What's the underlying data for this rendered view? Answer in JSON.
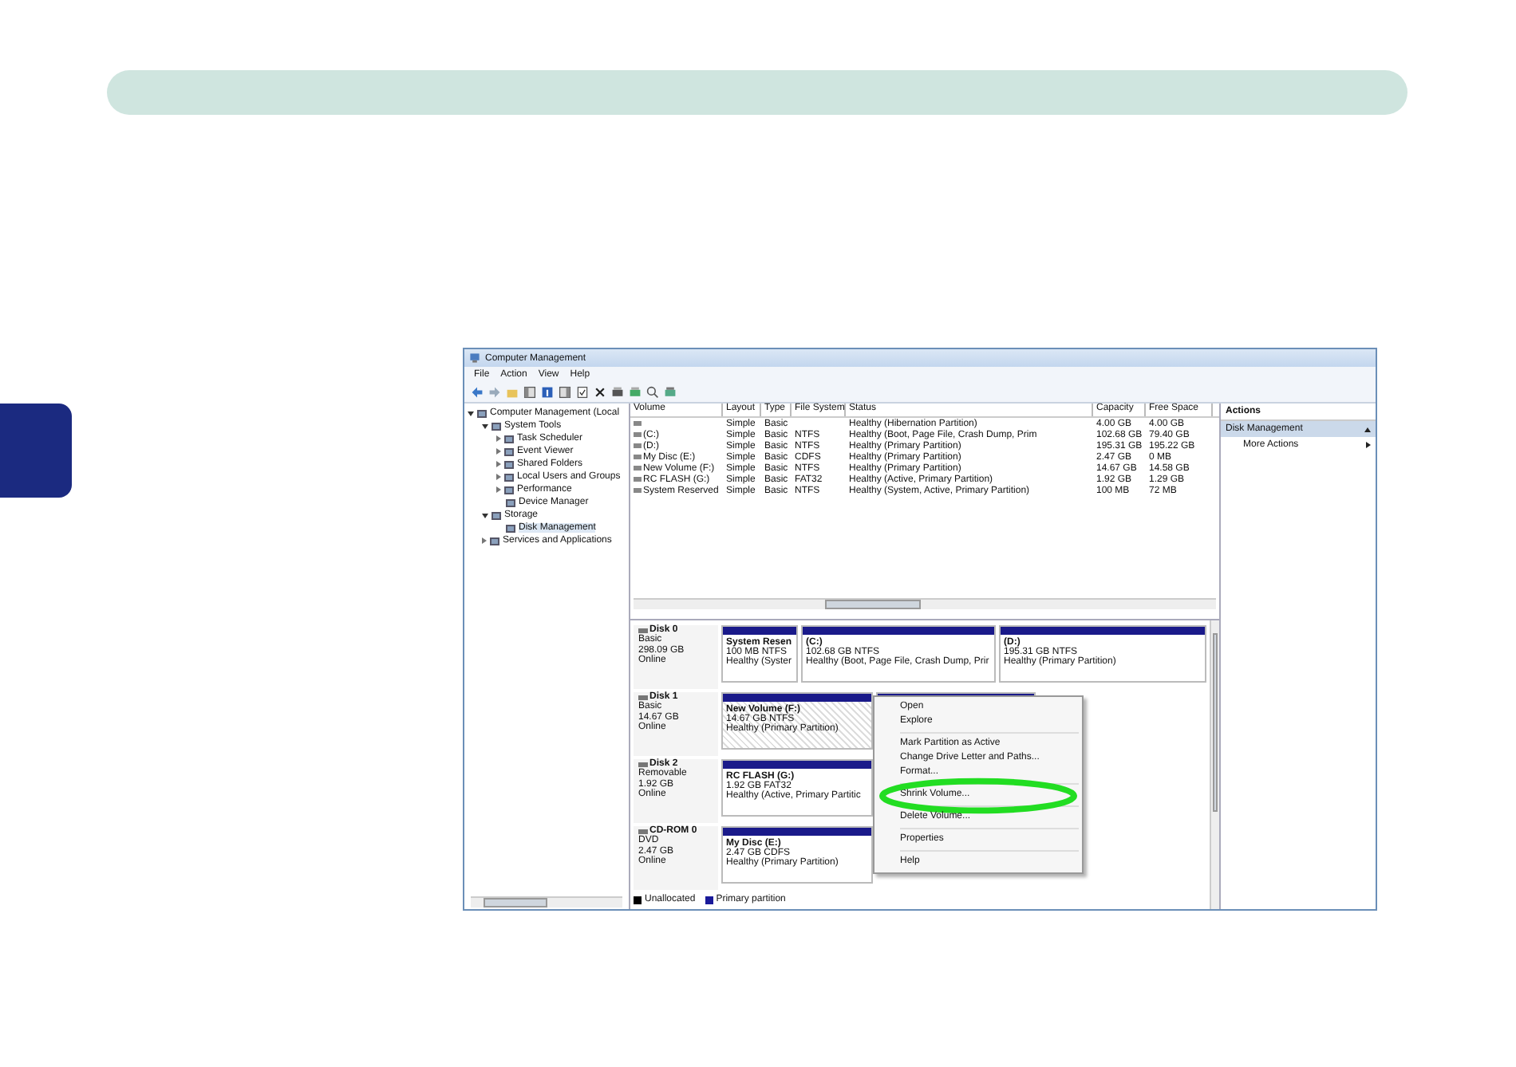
{
  "window": {
    "title": "Computer Management"
  },
  "menu": [
    "File",
    "Action",
    "View",
    "Help"
  ],
  "tree": [
    {
      "label": "Computer Management (Local",
      "expanded": true,
      "children": [
        {
          "label": "System Tools",
          "expanded": true,
          "children": [
            {
              "label": "Task Scheduler",
              "expanded": false
            },
            {
              "label": "Event Viewer",
              "expanded": false
            },
            {
              "label": "Shared Folders",
              "expanded": false
            },
            {
              "label": "Local Users and Groups",
              "expanded": false
            },
            {
              "label": "Performance",
              "expanded": false
            },
            {
              "label": "Device Manager"
            }
          ]
        },
        {
          "label": "Storage",
          "expanded": true,
          "children": [
            {
              "label": "Disk Management",
              "selected": true
            }
          ]
        },
        {
          "label": "Services and Applications",
          "expanded": false
        }
      ]
    }
  ],
  "table": {
    "columns": [
      "Volume",
      "Layout",
      "Type",
      "File System",
      "Status",
      "Capacity",
      "Free Space"
    ],
    "rows": [
      [
        "",
        "Simple",
        "Basic",
        "",
        "Healthy (Hibernation Partition)",
        "4.00 GB",
        "4.00 GB"
      ],
      [
        "(C:)",
        "Simple",
        "Basic",
        "NTFS",
        "Healthy (Boot, Page File, Crash Dump, Prim",
        "102.68 GB",
        "79.40 GB"
      ],
      [
        "(D:)",
        "Simple",
        "Basic",
        "NTFS",
        "Healthy (Primary Partition)",
        "195.31 GB",
        "195.22 GB"
      ],
      [
        "My Disc (E:)",
        "Simple",
        "Basic",
        "CDFS",
        "Healthy (Primary Partition)",
        "2.47 GB",
        "0 MB"
      ],
      [
        "New Volume (F:)",
        "Simple",
        "Basic",
        "NTFS",
        "Healthy (Primary Partition)",
        "14.67 GB",
        "14.58 GB"
      ],
      [
        "RC FLASH (G:)",
        "Simple",
        "Basic",
        "FAT32",
        "Healthy (Active, Primary Partition)",
        "1.92 GB",
        "1.29 GB"
      ],
      [
        "System Reserved",
        "Simple",
        "Basic",
        "NTFS",
        "Healthy (System, Active, Primary Partition)",
        "100 MB",
        "72 MB"
      ]
    ]
  },
  "disks": [
    {
      "name": "Disk 0",
      "lines": [
        "Basic",
        "298.09 GB",
        "Online"
      ],
      "partitions": [
        {
          "name": "System Resen",
          "size": "100 MB NTFS",
          "status": "Healthy (Syster",
          "selected": false
        },
        {
          "name": "(C:)",
          "size": "102.68 GB NTFS",
          "status": "Healthy (Boot, Page File, Crash Dump, Prir",
          "selected": false
        },
        {
          "name": "(D:)",
          "size": "195.31 GB NTFS",
          "status": "Healthy (Primary Partition)",
          "selected": false
        }
      ]
    },
    {
      "name": "Disk 1",
      "lines": [
        "Basic",
        "14.67 GB",
        "Online"
      ],
      "partitions": [
        {
          "name": "New Volume  (F:)",
          "size": "14.67 GB NTFS",
          "status": "Healthy (Primary Partition)",
          "selected": true
        },
        {
          "selected": false
        }
      ]
    },
    {
      "name": "Disk 2",
      "lines": [
        "Removable",
        "1.92 GB",
        "Online"
      ],
      "partitions": [
        {
          "name": "RC FLASH  (G:)",
          "size": "1.92 GB FAT32",
          "status": "Healthy (Active, Primary Partitic",
          "selected": false
        }
      ]
    },
    {
      "name": "CD-ROM 0",
      "lines": [
        "DVD",
        "2.47 GB",
        "Online"
      ],
      "partitions": [
        {
          "name": "My Disc  (E:)",
          "size": "2.47 GB CDFS",
          "status": "Healthy (Primary Partition)",
          "selected": false
        }
      ]
    }
  ],
  "legend": [
    {
      "label": "Unallocated",
      "color": "#000000"
    },
    {
      "label": "Primary partition",
      "color": "#1a1a9a"
    }
  ],
  "actions": {
    "title": "Actions",
    "items": [
      {
        "label": "Disk Management",
        "kind": "section"
      },
      {
        "label": "More Actions",
        "kind": "link"
      }
    ]
  },
  "context_menu": [
    {
      "kind": "item",
      "label": "Open",
      "highlighted": false
    },
    {
      "kind": "item",
      "label": "Explore",
      "highlighted": false
    },
    {
      "kind": "separator"
    },
    {
      "kind": "item",
      "label": "Mark Partition as Active",
      "highlighted": false
    },
    {
      "kind": "item",
      "label": "Change Drive Letter and Paths...",
      "highlighted": false
    },
    {
      "kind": "item",
      "label": "Format...",
      "highlighted": false
    },
    {
      "kind": "separator"
    },
    {
      "kind": "item",
      "label": "Shrink Volume...",
      "highlighted": true
    },
    {
      "kind": "separator"
    },
    {
      "kind": "item",
      "label": "Delete Volume...",
      "highlighted": false
    },
    {
      "kind": "separator"
    },
    {
      "kind": "item",
      "label": "Properties",
      "highlighted": false
    },
    {
      "kind": "separator"
    },
    {
      "kind": "item",
      "label": "Help",
      "highlighted": false
    }
  ]
}
